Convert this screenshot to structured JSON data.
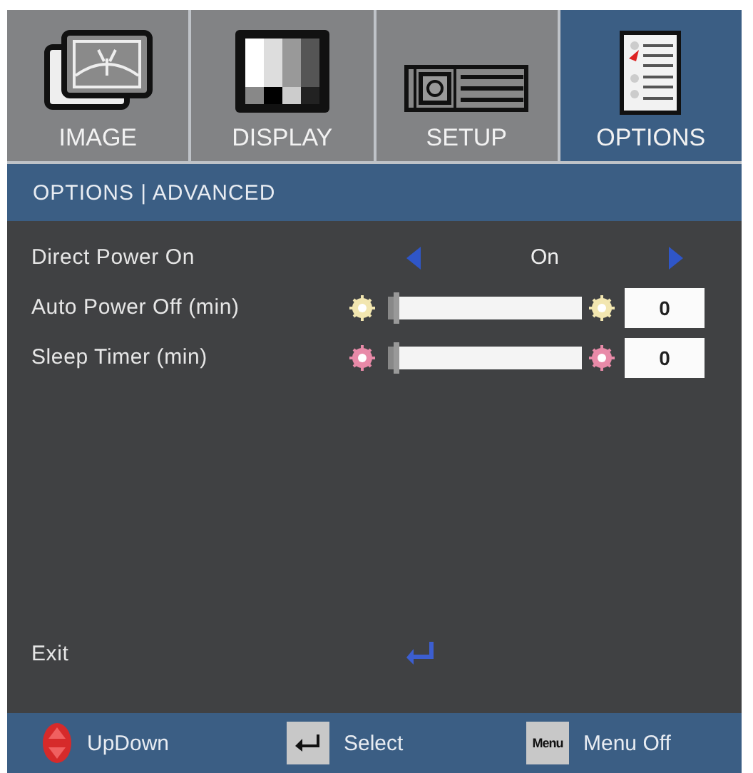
{
  "tabs": [
    {
      "kind": "image",
      "label": "IMAGE",
      "selected": false
    },
    {
      "kind": "display",
      "label": "DISPLAY",
      "selected": false
    },
    {
      "kind": "setup",
      "label": "SETUP",
      "selected": false
    },
    {
      "kind": "options",
      "label": "OPTIONS",
      "selected": true
    }
  ],
  "breadcrumb": "OPTIONS | ADVANCED",
  "items": [
    {
      "kind": "choice",
      "label": "Direct Power On",
      "value": "On"
    },
    {
      "kind": "slider",
      "label": "Auto Power Off (min)",
      "level": 0,
      "value": "0",
      "color": "#f2e6b0"
    },
    {
      "kind": "slider",
      "label": "Sleep Timer (min)",
      "level": 0,
      "value": "0",
      "color": "#e88aa8"
    }
  ],
  "exit": {
    "label": "Exit"
  },
  "footer": [
    {
      "kind": "updown",
      "label": "UpDown"
    },
    {
      "kind": "enter",
      "label": "Select"
    },
    {
      "kind": "menu",
      "key": "Menu",
      "label": "Menu Off"
    }
  ]
}
